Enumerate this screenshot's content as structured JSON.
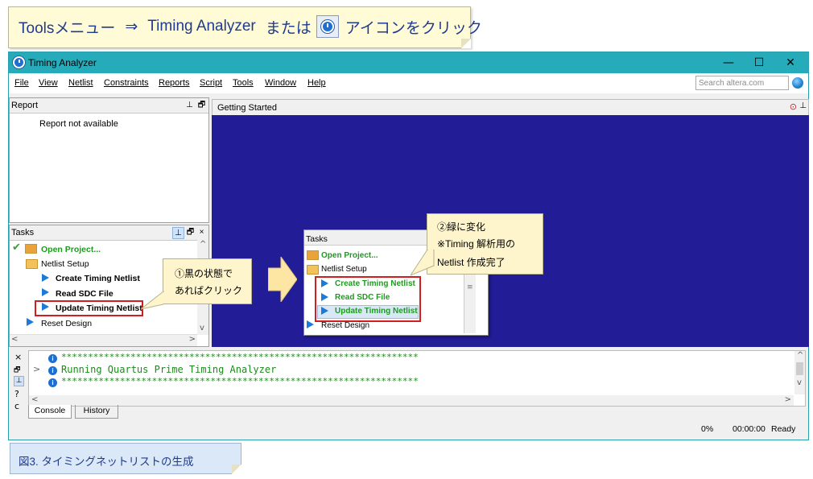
{
  "instruction": {
    "part1": "Toolsメニュー",
    "arrow": "⇒",
    "part2": "Timing Analyzer",
    "part3": "または",
    "part4": "アイコンをクリック"
  },
  "window": {
    "title": "Timing Analyzer",
    "minimize": "—",
    "maximize": "☐",
    "close": "✕"
  },
  "menu": [
    "File",
    "View",
    "Netlist",
    "Constraints",
    "Reports",
    "Script",
    "Tools",
    "Window",
    "Help"
  ],
  "search": {
    "placeholder": "Search altera.com"
  },
  "report_panel": {
    "title": "Report",
    "empty_text": "Report not available"
  },
  "tasks_panel": {
    "title": "Tasks",
    "items": [
      {
        "label": "Open Project...",
        "state": "done"
      },
      {
        "label": "Netlist Setup",
        "state": "folder"
      },
      {
        "label": "Create Timing Netlist",
        "state": "black"
      },
      {
        "label": "Read SDC File",
        "state": "black"
      },
      {
        "label": "Update Timing Netlist",
        "state": "black"
      },
      {
        "label": "Reset Design",
        "state": "normal"
      }
    ]
  },
  "getting_started": {
    "title": "Getting Started"
  },
  "callout1": {
    "line1": "①黒の状態で",
    "line2": "あればクリック"
  },
  "callout2": {
    "line1": "②緑に変化",
    "line2": "※Timing 解析用の",
    "line3": "Netlist 作成完了"
  },
  "inset_tasks": {
    "title": "Tasks",
    "items": [
      {
        "label": "Open Project..."
      },
      {
        "label": "Netlist Setup"
      },
      {
        "label": "Create Timing Netlist"
      },
      {
        "label": "Read SDC File"
      },
      {
        "label": "Update Timing Netlist"
      },
      {
        "label": "Reset Design"
      }
    ]
  },
  "console": {
    "lines": [
      "*******************************************************************",
      "Running Quartus Prime Timing Analyzer",
      "*******************************************************************"
    ],
    "side_buttons": [
      "×",
      "🗗",
      "⊥",
      "?",
      "c"
    ],
    "tabs": [
      "Console",
      "History"
    ]
  },
  "statusbar": {
    "progress": "0%",
    "elapsed": "00:00:00",
    "status": "Ready"
  },
  "caption": "図3. タイミングネットリストの生成",
  "colors": {
    "accent": "#26abba",
    "canvas": "#221c97",
    "done_green": "#1e9a1e",
    "highlight_red": "#d01f1f"
  }
}
